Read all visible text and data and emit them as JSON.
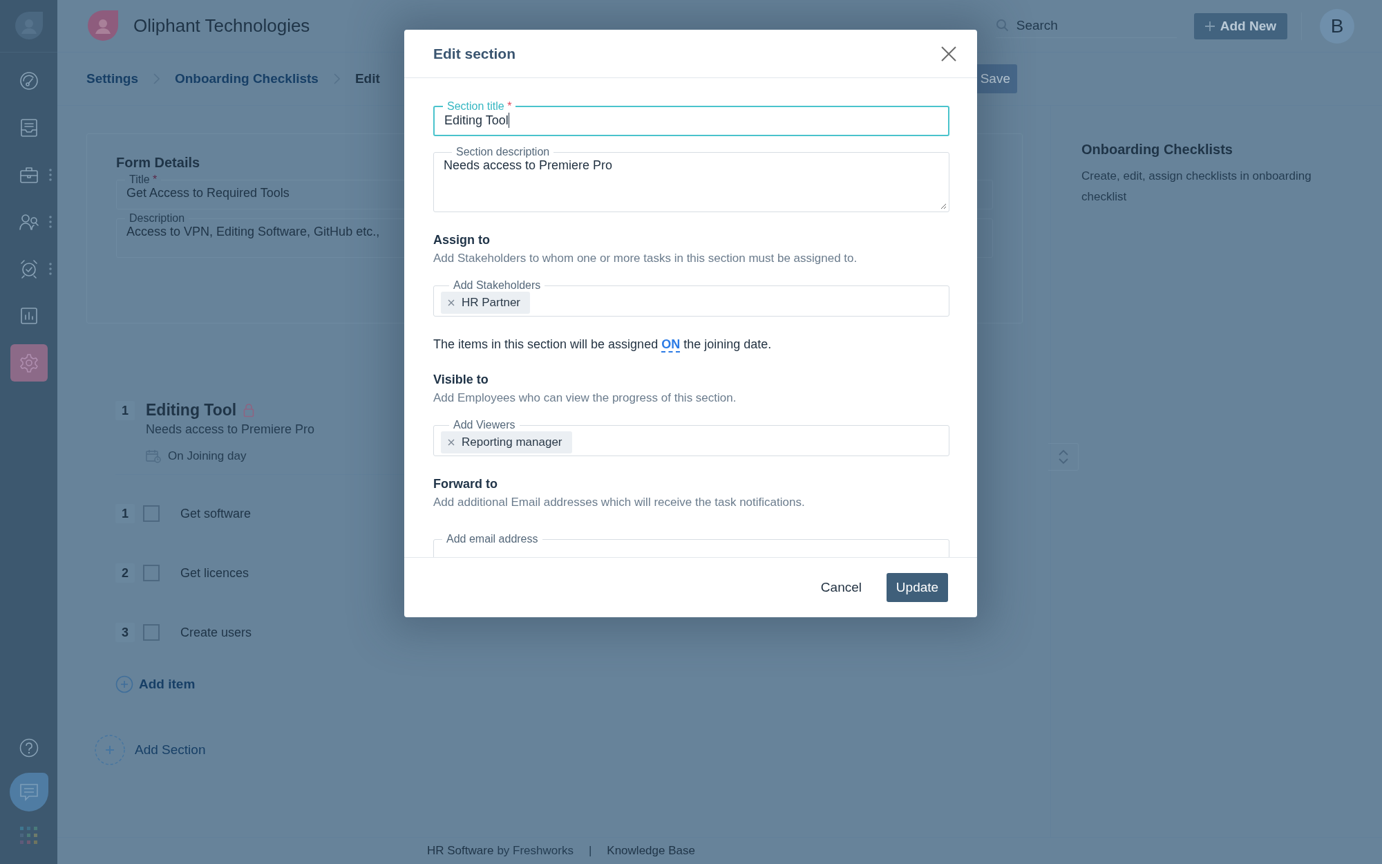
{
  "app": {
    "name": "Oliphant Technologies"
  },
  "sidebar": {
    "items": [
      {
        "kind": "gauge",
        "selected": false,
        "more": false
      },
      {
        "kind": "inbox",
        "selected": false,
        "more": false
      },
      {
        "kind": "briefcase",
        "selected": false,
        "more": true
      },
      {
        "kind": "people",
        "selected": false,
        "more": true
      },
      {
        "kind": "alarm",
        "selected": false,
        "more": true
      },
      {
        "kind": "chart",
        "selected": false,
        "more": false
      },
      {
        "kind": "gear",
        "selected": true,
        "more": false
      }
    ]
  },
  "search": {
    "placeholder": "Search"
  },
  "add_new_button": {
    "label": "Add New"
  },
  "avatar": {
    "initial": "B"
  },
  "breadcrumbs": [
    {
      "label": "Settings",
      "current": false
    },
    {
      "label": "Onboarding Checklists",
      "current": false
    },
    {
      "label": "Edit",
      "current": true
    }
  ],
  "save_button": {
    "label": "Save"
  },
  "form_details": {
    "title": "Form Details",
    "fields": [
      {
        "label": "Title",
        "required_mark": "*",
        "value": "Get Access to Required Tools"
      },
      {
        "label": "Description",
        "value": "Access to VPN, Editing Software, GitHub etc.,"
      }
    ]
  },
  "section": {
    "number": "1",
    "title": "Editing Tool",
    "locked": true,
    "description": "Needs access to Premiere Pro",
    "schedule": "On Joining day",
    "items": [
      {
        "number": "1",
        "label": "Get software",
        "checked": false
      },
      {
        "number": "2",
        "label": "Get licences",
        "checked": false
      },
      {
        "number": "3",
        "label": "Create users",
        "checked": false
      }
    ]
  },
  "add_item": "Add item",
  "add_section": "Add Section",
  "help_panel": {
    "title": "Onboarding Checklists",
    "text": "Create, edit, assign checklists in onboarding checklist"
  },
  "footer": {
    "product": "HR Software",
    "by": "by Freshworks",
    "separator": "|",
    "link": "Knowledge Base"
  },
  "dialog": {
    "title": "Edit section",
    "title_field": {
      "label": "Section title",
      "required_mark": "*",
      "value": "Editing Tool",
      "focused": true
    },
    "description_field": {
      "label": "Section description",
      "value": "Needs access to Premiere Pro"
    },
    "groups": [
      {
        "kind": "tags",
        "heading": "Assign to",
        "description": "Add Stakeholders to whom one or more tasks in this section must be assigned to.",
        "field_label": "Add Stakeholders",
        "tags": [
          "HR Partner"
        ]
      },
      {
        "kind": "sentence",
        "before": "The items in this section will be assigned",
        "link": "ON",
        "after": "the joining date."
      },
      {
        "kind": "tags",
        "heading": "Visible to",
        "description": "Add Employees who can view the progress of this section.",
        "field_label": "Add Viewers",
        "tags": [
          "Reporting manager"
        ]
      },
      {
        "kind": "email",
        "heading": "Forward to",
        "description": "Add additional Email addresses which will receive the task notifications.",
        "field_label": "Add email address"
      }
    ],
    "cancel": "Cancel",
    "submit": "Update"
  }
}
